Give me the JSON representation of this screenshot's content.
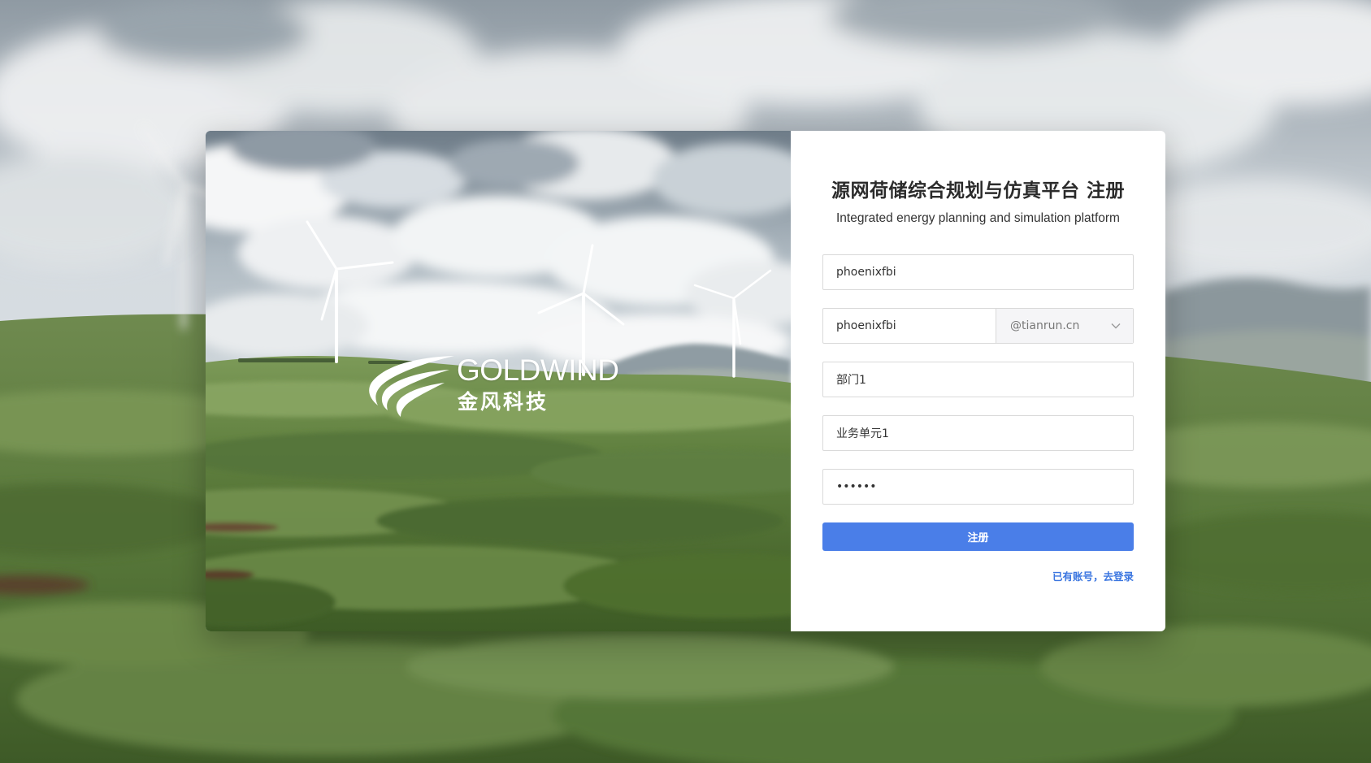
{
  "brand": {
    "name_en": "GOLDWIND",
    "name_cn": "金风科技"
  },
  "form": {
    "title": "源网荷储综合规划与仿真平台 注册",
    "subtitle": "Integrated energy planning and simulation platform",
    "username_value": "phoenixfbi",
    "email_user_value": "phoenixfbi",
    "email_domain_value": "@tianrun.cn",
    "department_value": "部门1",
    "business_unit_value": "业务单元1",
    "password_value": "123456",
    "submit_label": "注册",
    "login_link": "已有账号，去登录"
  },
  "colors": {
    "primary": "#4a7ee8",
    "link": "#3b76e0",
    "grass": "#5f7f45",
    "sky": "#c9d3db"
  },
  "icons": {
    "dropdown": "chevron-down-icon"
  }
}
